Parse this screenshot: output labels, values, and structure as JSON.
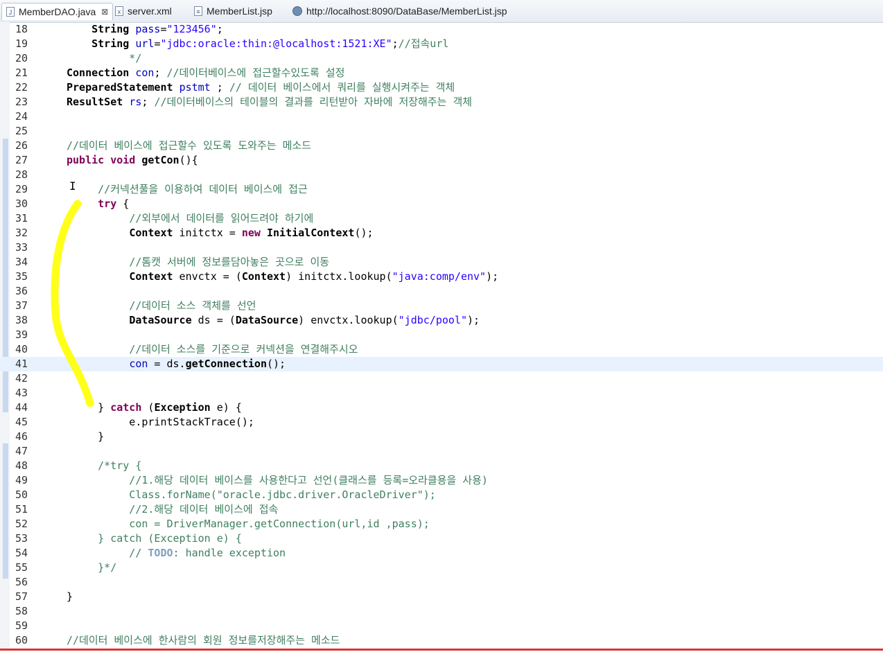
{
  "tabs": [
    {
      "label": "MemberDAO.java",
      "icon": "java-file-icon",
      "close": "⊠"
    },
    {
      "label": "server.xml",
      "icon": "xml-file-icon"
    },
    {
      "label": "MemberList.jsp",
      "icon": "jsp-file-icon"
    },
    {
      "label": "http://localhost:8090/DataBase/MemberList.jsp",
      "icon": "globe-icon"
    }
  ],
  "editor": {
    "line_numbers": [
      "18",
      "19",
      "20",
      "21",
      "22",
      "23",
      "24",
      "25",
      "26",
      "27",
      "28",
      "29",
      "30",
      "31",
      "32",
      "33",
      "34",
      "35",
      "36",
      "37",
      "38",
      "39",
      "40",
      "41",
      "42",
      "43",
      "44",
      "45",
      "46",
      "47",
      "48",
      "49",
      "50",
      "51",
      "52",
      "53",
      "54",
      "55",
      "56",
      "57",
      "58",
      "59",
      "60"
    ],
    "current_line": "41",
    "colors": {
      "keyword": "#7f0055",
      "string": "#2a00ff",
      "comment": "#3f7f5f",
      "field": "#0000c0",
      "highlight": "#ffff00"
    }
  }
}
